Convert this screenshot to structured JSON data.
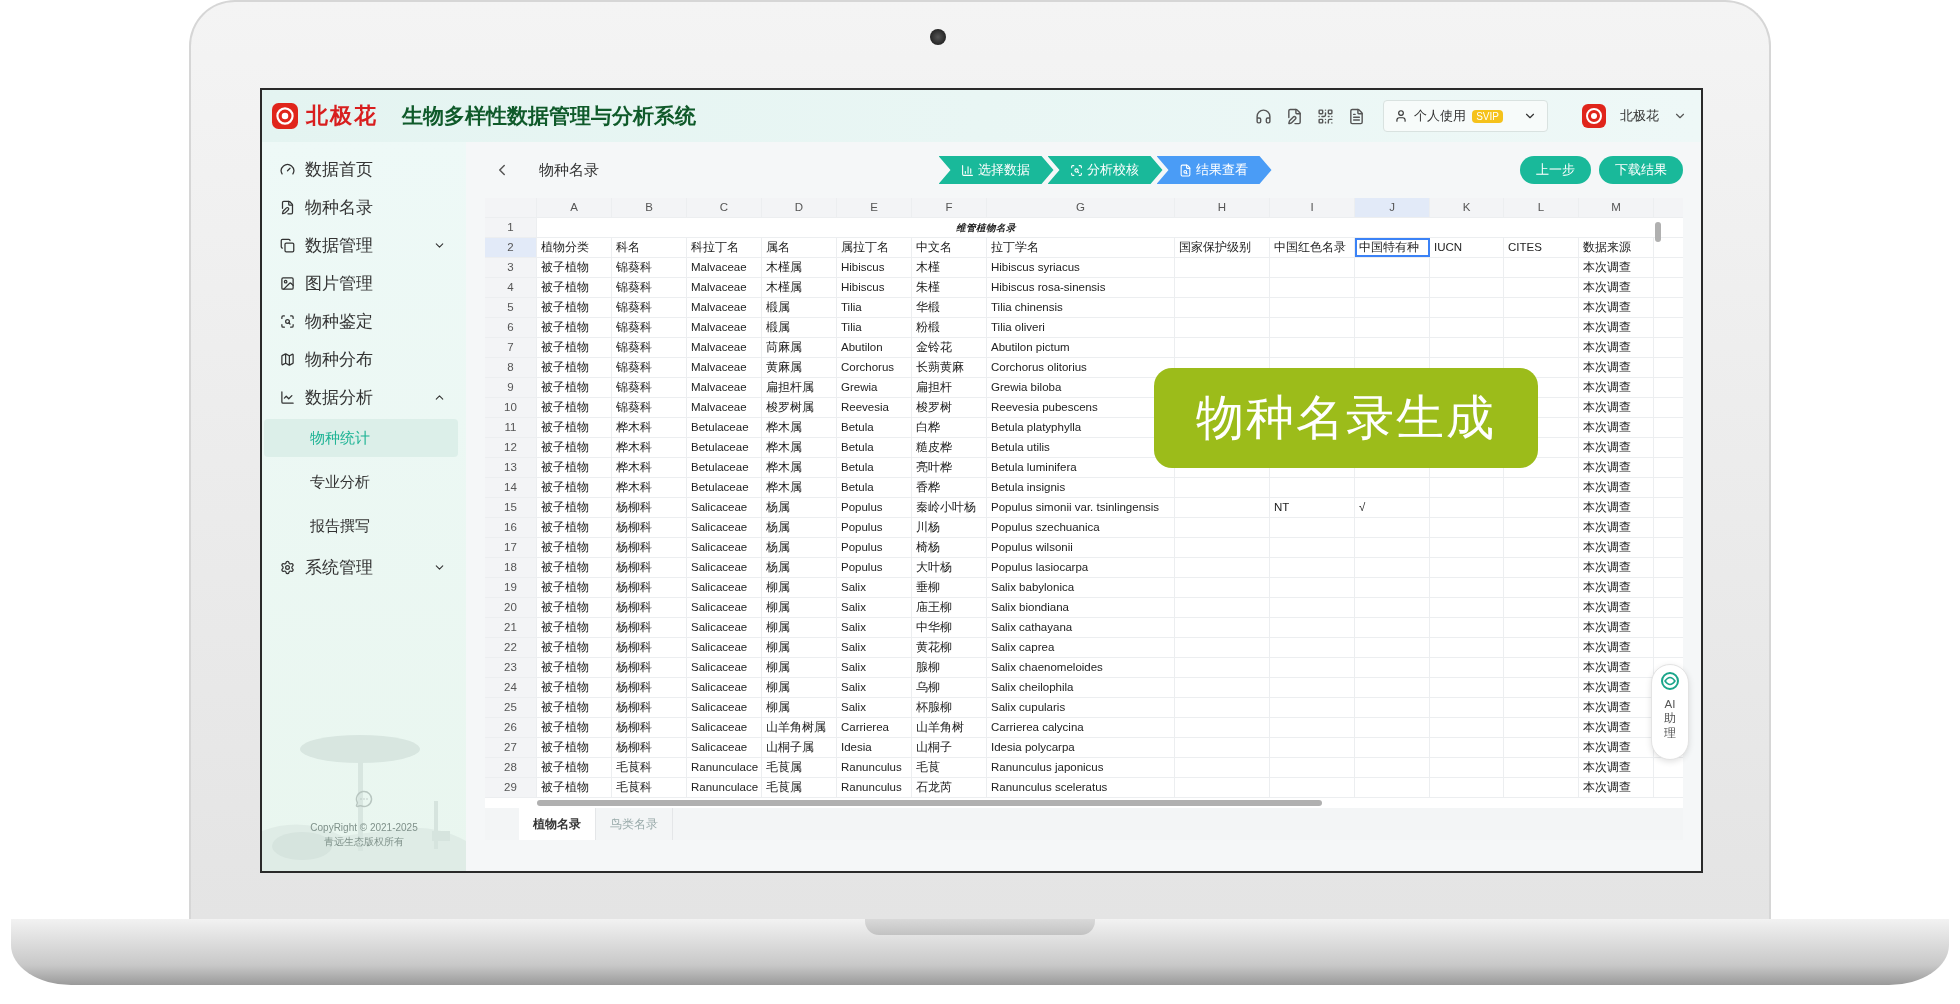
{
  "header": {
    "brand": "北极花",
    "title": "生物多样性数据管理与分析系统",
    "account": "个人使用",
    "badge": "SVIP",
    "user": "北极花"
  },
  "sidebar": {
    "items": [
      {
        "label": "数据首页"
      },
      {
        "label": "物种名录"
      },
      {
        "label": "数据管理",
        "expanded": false
      },
      {
        "label": "图片管理"
      },
      {
        "label": "物种鉴定"
      },
      {
        "label": "物种分布"
      },
      {
        "label": "数据分析",
        "expanded": true,
        "children": [
          {
            "label": "物种统计",
            "selected": true
          },
          {
            "label": "专业分析",
            "selected": false
          },
          {
            "label": "报告撰写",
            "selected": false
          }
        ]
      },
      {
        "label": "系统管理",
        "expanded": false
      }
    ],
    "copyright": "CopyRight © 2021-2025",
    "owner": "青远生态版权所有"
  },
  "toolbar": {
    "title": "物种名录",
    "steps": [
      {
        "label": "选择数据",
        "selected": false
      },
      {
        "label": "分析校核",
        "selected": false
      },
      {
        "label": "结果查看",
        "selected": true
      }
    ],
    "buttons": [
      "上一步",
      "下载结果"
    ]
  },
  "table": {
    "columns": [
      {
        "label": "A",
        "selected": false
      },
      {
        "label": "B",
        "selected": false
      },
      {
        "label": "C",
        "selected": false
      },
      {
        "label": "D",
        "selected": false
      },
      {
        "label": "E",
        "selected": false
      },
      {
        "label": "F",
        "selected": false
      },
      {
        "label": "G",
        "selected": false
      },
      {
        "label": "H",
        "selected": false
      },
      {
        "label": "I",
        "selected": false
      },
      {
        "label": "J",
        "selected": true
      },
      {
        "label": "K",
        "selected": false
      },
      {
        "label": "L",
        "selected": false
      },
      {
        "label": "M",
        "selected": false
      }
    ],
    "rows": [
      {
        "number": "1",
        "selected": false,
        "title": "维管植物名录"
      },
      {
        "number": "2",
        "selected": true,
        "group": "植物分类",
        "family": "科名",
        "family_latin": "科拉丁名",
        "genus": "属名",
        "genus_latin": "属拉丁名",
        "name_cn": "中文名",
        "name_latin": "拉丁学名",
        "protection": "国家保护级别",
        "red_list": "中国红色名录",
        "endemic": "中国特有种",
        "iucn": "IUCN",
        "cites": "CITES",
        "source": "数据来源"
      },
      {
        "number": "3",
        "selected": false,
        "group": "被子植物",
        "family": "锦葵科",
        "family_latin": "Malvaceae",
        "genus": "木槿属",
        "genus_latin": "Hibiscus",
        "name_cn": "木槿",
        "name_latin": "Hibiscus syriacus",
        "source": "本次调查"
      },
      {
        "number": "4",
        "selected": false,
        "group": "被子植物",
        "family": "锦葵科",
        "family_latin": "Malvaceae",
        "genus": "木槿属",
        "genus_latin": "Hibiscus",
        "name_cn": "朱槿",
        "name_latin": "Hibiscus rosa-sinensis",
        "source": "本次调查"
      },
      {
        "number": "5",
        "selected": false,
        "group": "被子植物",
        "family": "锦葵科",
        "family_latin": "Malvaceae",
        "genus": "椴属",
        "genus_latin": "Tilia",
        "name_cn": "华椴",
        "name_latin": "Tilia chinensis",
        "source": "本次调查"
      },
      {
        "number": "6",
        "selected": false,
        "group": "被子植物",
        "family": "锦葵科",
        "family_latin": "Malvaceae",
        "genus": "椴属",
        "genus_latin": "Tilia",
        "name_cn": "粉椴",
        "name_latin": "Tilia oliveri",
        "source": "本次调查"
      },
      {
        "number": "7",
        "selected": false,
        "group": "被子植物",
        "family": "锦葵科",
        "family_latin": "Malvaceae",
        "genus": "苘麻属",
        "genus_latin": "Abutilon",
        "name_cn": "金铃花",
        "name_latin": "Abutilon pictum",
        "source": "本次调查"
      },
      {
        "number": "8",
        "selected": false,
        "group": "被子植物",
        "family": "锦葵科",
        "family_latin": "Malvaceae",
        "genus": "黄麻属",
        "genus_latin": "Corchorus",
        "name_cn": "长蒴黄麻",
        "name_latin": "Corchorus olitorius",
        "source": "本次调查"
      },
      {
        "number": "9",
        "selected": false,
        "group": "被子植物",
        "family": "锦葵科",
        "family_latin": "Malvaceae",
        "genus": "扁担杆属",
        "genus_latin": "Grewia",
        "name_cn": "扁担杆",
        "name_latin": "Grewia biloba",
        "source": "本次调查"
      },
      {
        "number": "10",
        "selected": false,
        "group": "被子植物",
        "family": "锦葵科",
        "family_latin": "Malvaceae",
        "genus": "梭罗树属",
        "genus_latin": "Reevesia",
        "name_cn": "梭罗树",
        "name_latin": "Reevesia pubescens",
        "source": "本次调查"
      },
      {
        "number": "11",
        "selected": false,
        "group": "被子植物",
        "family": "桦木科",
        "family_latin": "Betulaceae",
        "genus": "桦木属",
        "genus_latin": "Betula",
        "name_cn": "白桦",
        "name_latin": "Betula platyphylla",
        "source": "本次调查"
      },
      {
        "number": "12",
        "selected": false,
        "group": "被子植物",
        "family": "桦木科",
        "family_latin": "Betulaceae",
        "genus": "桦木属",
        "genus_latin": "Betula",
        "name_cn": "糙皮桦",
        "name_latin": "Betula utilis",
        "source": "本次调查"
      },
      {
        "number": "13",
        "selected": false,
        "group": "被子植物",
        "family": "桦木科",
        "family_latin": "Betulaceae",
        "genus": "桦木属",
        "genus_latin": "Betula",
        "name_cn": "亮叶桦",
        "name_latin": "Betula luminifera",
        "source": "本次调查"
      },
      {
        "number": "14",
        "selected": false,
        "group": "被子植物",
        "family": "桦木科",
        "family_latin": "Betulaceae",
        "genus": "桦木属",
        "genus_latin": "Betula",
        "name_cn": "香桦",
        "name_latin": "Betula insignis",
        "source": "本次调查"
      },
      {
        "number": "15",
        "selected": false,
        "group": "被子植物",
        "family": "杨柳科",
        "family_latin": "Salicaceae",
        "genus": "杨属",
        "genus_latin": "Populus",
        "name_cn": "秦岭小叶杨",
        "name_latin": "Populus simonii var. tsinlingensis",
        "red_list": "NT",
        "endemic": "√",
        "source": "本次调查"
      },
      {
        "number": "16",
        "selected": false,
        "group": "被子植物",
        "family": "杨柳科",
        "family_latin": "Salicaceae",
        "genus": "杨属",
        "genus_latin": "Populus",
        "name_cn": "川杨",
        "name_latin": "Populus szechuanica",
        "source": "本次调查"
      },
      {
        "number": "17",
        "selected": false,
        "group": "被子植物",
        "family": "杨柳科",
        "family_latin": "Salicaceae",
        "genus": "杨属",
        "genus_latin": "Populus",
        "name_cn": "椅杨",
        "name_latin": "Populus wilsonii",
        "source": "本次调查"
      },
      {
        "number": "18",
        "selected": false,
        "group": "被子植物",
        "family": "杨柳科",
        "family_latin": "Salicaceae",
        "genus": "杨属",
        "genus_latin": "Populus",
        "name_cn": "大叶杨",
        "name_latin": "Populus lasiocarpa",
        "source": "本次调查"
      },
      {
        "number": "19",
        "selected": false,
        "group": "被子植物",
        "family": "杨柳科",
        "family_latin": "Salicaceae",
        "genus": "柳属",
        "genus_latin": "Salix",
        "name_cn": "垂柳",
        "name_latin": "Salix babylonica",
        "source": "本次调查"
      },
      {
        "number": "20",
        "selected": false,
        "group": "被子植物",
        "family": "杨柳科",
        "family_latin": "Salicaceae",
        "genus": "柳属",
        "genus_latin": "Salix",
        "name_cn": "庙王柳",
        "name_latin": "Salix biondiana",
        "source": "本次调查"
      },
      {
        "number": "21",
        "selected": false,
        "group": "被子植物",
        "family": "杨柳科",
        "family_latin": "Salicaceae",
        "genus": "柳属",
        "genus_latin": "Salix",
        "name_cn": "中华柳",
        "name_latin": "Salix cathayana",
        "source": "本次调查"
      },
      {
        "number": "22",
        "selected": false,
        "group": "被子植物",
        "family": "杨柳科",
        "family_latin": "Salicaceae",
        "genus": "柳属",
        "genus_latin": "Salix",
        "name_cn": "黄花柳",
        "name_latin": "Salix caprea",
        "source": "本次调查"
      },
      {
        "number": "23",
        "selected": false,
        "group": "被子植物",
        "family": "杨柳科",
        "family_latin": "Salicaceae",
        "genus": "柳属",
        "genus_latin": "Salix",
        "name_cn": "腺柳",
        "name_latin": "Salix chaenomeloides",
        "source": "本次调查"
      },
      {
        "number": "24",
        "selected": false,
        "group": "被子植物",
        "family": "杨柳科",
        "family_latin": "Salicaceae",
        "genus": "柳属",
        "genus_latin": "Salix",
        "name_cn": "乌柳",
        "name_latin": "Salix cheilophila",
        "source": "本次调查"
      },
      {
        "number": "25",
        "selected": false,
        "group": "被子植物",
        "family": "杨柳科",
        "family_latin": "Salicaceae",
        "genus": "柳属",
        "genus_latin": "Salix",
        "name_cn": "杯腺柳",
        "name_latin": "Salix cupularis",
        "source": "本次调查"
      },
      {
        "number": "26",
        "selected": false,
        "group": "被子植物",
        "family": "杨柳科",
        "family_latin": "Salicaceae",
        "genus": "山羊角树属",
        "genus_latin": "Carrierea",
        "name_cn": "山羊角树",
        "name_latin": "Carrierea calycina",
        "source": "本次调查"
      },
      {
        "number": "27",
        "selected": false,
        "group": "被子植物",
        "family": "杨柳科",
        "family_latin": "Salicaceae",
        "genus": "山桐子属",
        "genus_latin": "Idesia",
        "name_cn": "山桐子",
        "name_latin": "Idesia polycarpa",
        "source": "本次调查"
      },
      {
        "number": "28",
        "selected": false,
        "group": "被子植物",
        "family": "毛茛科",
        "family_latin": "Ranunculace",
        "genus": "毛茛属",
        "genus_latin": "Ranunculus",
        "name_cn": "毛茛",
        "name_latin": "Ranunculus japonicus",
        "source": "本次调查"
      },
      {
        "number": "29",
        "selected": false,
        "group": "被子植物",
        "family": "毛茛科",
        "family_latin": "Ranunculace",
        "genus": "毛茛属",
        "genus_latin": "Ranunculus",
        "name_cn": "石龙芮",
        "name_latin": "Ranunculus sceleratus",
        "source": "本次调查"
      }
    ]
  },
  "sheet_tabs": [
    {
      "label": "植物名录",
      "selected": true
    },
    {
      "label": "鸟类名录",
      "selected": false
    }
  ],
  "banner": "物种名录生成",
  "assistant": "AI助理"
}
